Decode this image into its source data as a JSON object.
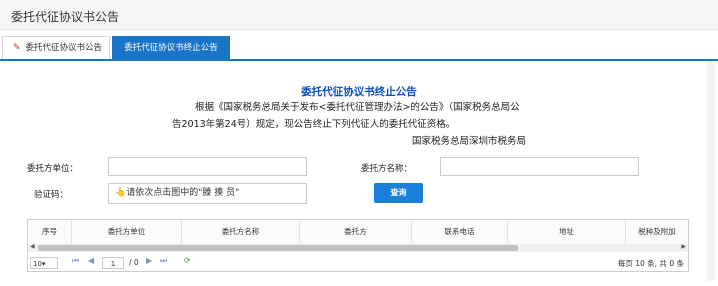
{
  "header": {
    "title": "委托代征协议书公告"
  },
  "tabs": [
    {
      "label": "委托代征协议书公告",
      "icon": "pin-icon"
    },
    {
      "label": "委托代征协议书终止公告"
    }
  ],
  "notice": {
    "title": "委托代征协议书终止公告",
    "line1": "根据《国家税务总局关于发布<委托代征管理办法>的公告》（国家税务总局公",
    "line2": "告2013年第24号）规定，现公告终止下列代征人的委托代征资格。",
    "signature": "国家税务总局深圳市税务局"
  },
  "form": {
    "unit_label": "委托方单位：",
    "unit_value": "",
    "name_label": "委托方名称：",
    "name_value": "",
    "captcha_label": "验证码：",
    "captcha_text": "👆请依次点击图中的\"滕 揍 员\"",
    "query_button": "查询"
  },
  "table": {
    "columns": [
      "序号",
      "委托方单位",
      "委托方名称",
      "委托方",
      "联系电话",
      "地址",
      "税种及附加"
    ]
  },
  "pager": {
    "page_size": "10",
    "page_size_arrow": "▾",
    "current_page": "1",
    "total_pages": "/ 0",
    "info": "每页 10 条, 共 0 条"
  }
}
